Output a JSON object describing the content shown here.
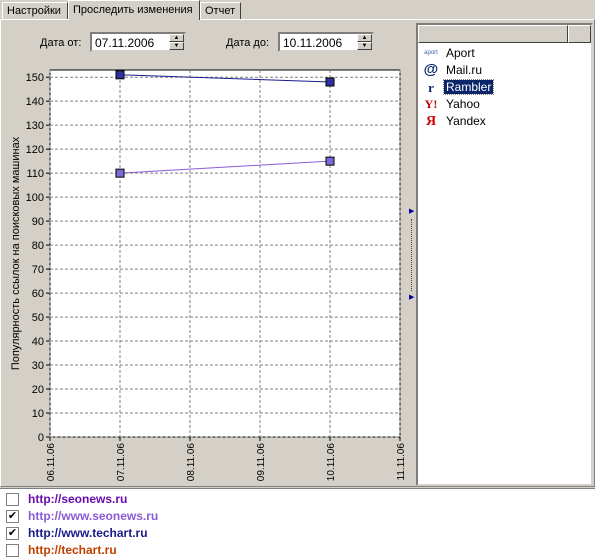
{
  "tabs": [
    {
      "label": "Настройки",
      "active": false
    },
    {
      "label": "Проследить изменения",
      "active": true
    },
    {
      "label": "Отчет",
      "active": false
    }
  ],
  "date_from": {
    "label": "Дата от:",
    "value": "07.11.2006"
  },
  "date_to": {
    "label": "Дата до:",
    "value": "10.11.2006"
  },
  "search_engines": [
    {
      "name": "Aport",
      "icon": "aport-icon",
      "selected": false
    },
    {
      "name": "Mail.ru",
      "icon": "mailru-icon",
      "selected": false
    },
    {
      "name": "Rambler",
      "icon": "rambler-icon",
      "selected": true
    },
    {
      "name": "Yahoo",
      "icon": "yahoo-icon",
      "selected": false
    },
    {
      "name": "Yandex",
      "icon": "yandex-icon",
      "selected": false
    }
  ],
  "urls": [
    {
      "url": "http://seonews.ru",
      "checked": false,
      "color": "#6a0dad"
    },
    {
      "url": "http://www.seonews.ru",
      "checked": true,
      "color": "#8a5cd6"
    },
    {
      "url": "http://www.techart.ru",
      "checked": true,
      "color": "#1a1a8a"
    },
    {
      "url": "http://techart.ru",
      "checked": false,
      "color": "#c04000"
    }
  ],
  "chart_data": {
    "type": "line",
    "ylabel": "Популярность ссылок на поисковых машинах",
    "xlabel": "",
    "x_ticks": [
      "06.11.06",
      "07.11.06",
      "08.11.06",
      "09.11.06",
      "10.11.06",
      "11.11.06"
    ],
    "y_ticks": [
      0,
      10,
      20,
      30,
      40,
      50,
      60,
      70,
      80,
      90,
      100,
      110,
      120,
      130,
      140,
      150
    ],
    "ylim": [
      0,
      153
    ],
    "xlim": [
      0,
      5
    ],
    "grid": true,
    "series": [
      {
        "x": [
          "07.11.06",
          "10.11.06"
        ],
        "values": [
          151,
          148
        ],
        "color": "#1a1a8a",
        "marker_color": "#3030a0"
      },
      {
        "x": [
          "07.11.06",
          "10.11.06"
        ],
        "values": [
          110,
          115
        ],
        "color": "#8a5cd6",
        "marker_color": "#7d6ad8"
      }
    ]
  }
}
